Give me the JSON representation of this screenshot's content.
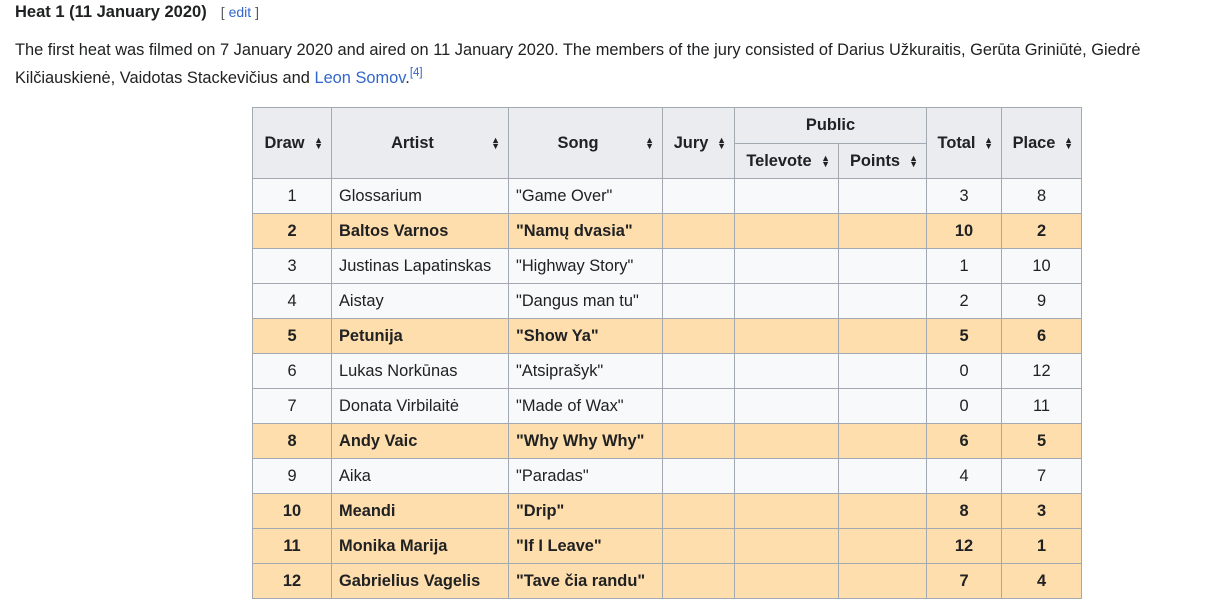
{
  "heading": {
    "title": "Heat 1 (11 January 2020)",
    "edit_open": "[",
    "edit_label": "edit",
    "edit_close": "]"
  },
  "paragraph": {
    "text_before_link": "The first heat was filmed on 7 January 2020 and aired on 11 January 2020. The members of the jury consisted of Darius Užkuraitis, Gerūta Griniūtė, Giedrė Kilčiauskienė, Vaidotas Stackevičius and ",
    "link_text": "Leon Somov",
    "text_after_link": ".",
    "citation": "[4]"
  },
  "table": {
    "headers": {
      "draw": "Draw",
      "artist": "Artist",
      "song": "Song",
      "jury": "Jury",
      "public": "Public",
      "televote": "Televote",
      "points": "Points",
      "total": "Total",
      "place": "Place"
    },
    "sort_icon": "sort-icon",
    "highlight_color": "#ffdead",
    "header_color": "#eaecf0",
    "rows": [
      {
        "draw": "1",
        "artist": "Glossarium",
        "song": "\"Game Over\"",
        "jury": "",
        "televote": "",
        "points": "",
        "total": "3",
        "place": "8",
        "highlight": false
      },
      {
        "draw": "2",
        "artist": "Baltos Varnos",
        "song": "\"Namų dvasia\"",
        "jury": "",
        "televote": "",
        "points": "",
        "total": "10",
        "place": "2",
        "highlight": true
      },
      {
        "draw": "3",
        "artist": "Justinas Lapatinskas",
        "song": "\"Highway Story\"",
        "jury": "",
        "televote": "",
        "points": "",
        "total": "1",
        "place": "10",
        "highlight": false
      },
      {
        "draw": "4",
        "artist": "Aistay",
        "song": "\"Dangus man tu\"",
        "jury": "",
        "televote": "",
        "points": "",
        "total": "2",
        "place": "9",
        "highlight": false
      },
      {
        "draw": "5",
        "artist": "Petunija",
        "song": "\"Show Ya\"",
        "jury": "",
        "televote": "",
        "points": "",
        "total": "5",
        "place": "6",
        "highlight": true
      },
      {
        "draw": "6",
        "artist": "Lukas Norkūnas",
        "song": "\"Atsiprašyk\"",
        "jury": "",
        "televote": "",
        "points": "",
        "total": "0",
        "place": "12",
        "highlight": false
      },
      {
        "draw": "7",
        "artist": "Donata Virbilaitė",
        "song": "\"Made of Wax\"",
        "jury": "",
        "televote": "",
        "points": "",
        "total": "0",
        "place": "11",
        "highlight": false
      },
      {
        "draw": "8",
        "artist": "Andy Vaic",
        "song": "\"Why Why Why\"",
        "jury": "",
        "televote": "",
        "points": "",
        "total": "6",
        "place": "5",
        "highlight": true
      },
      {
        "draw": "9",
        "artist": "Aika",
        "song": "\"Paradas\"",
        "jury": "",
        "televote": "",
        "points": "",
        "total": "4",
        "place": "7",
        "highlight": false
      },
      {
        "draw": "10",
        "artist": "Meandi",
        "song": "\"Drip\"",
        "jury": "",
        "televote": "",
        "points": "",
        "total": "8",
        "place": "3",
        "highlight": true
      },
      {
        "draw": "11",
        "artist": "Monika Marija",
        "song": "\"If I Leave\"",
        "jury": "",
        "televote": "",
        "points": "",
        "total": "12",
        "place": "1",
        "highlight": true
      },
      {
        "draw": "12",
        "artist": "Gabrielius Vagelis",
        "song": "\"Tave čia randu\"",
        "jury": "",
        "televote": "",
        "points": "",
        "total": "7",
        "place": "4",
        "highlight": true
      }
    ]
  }
}
